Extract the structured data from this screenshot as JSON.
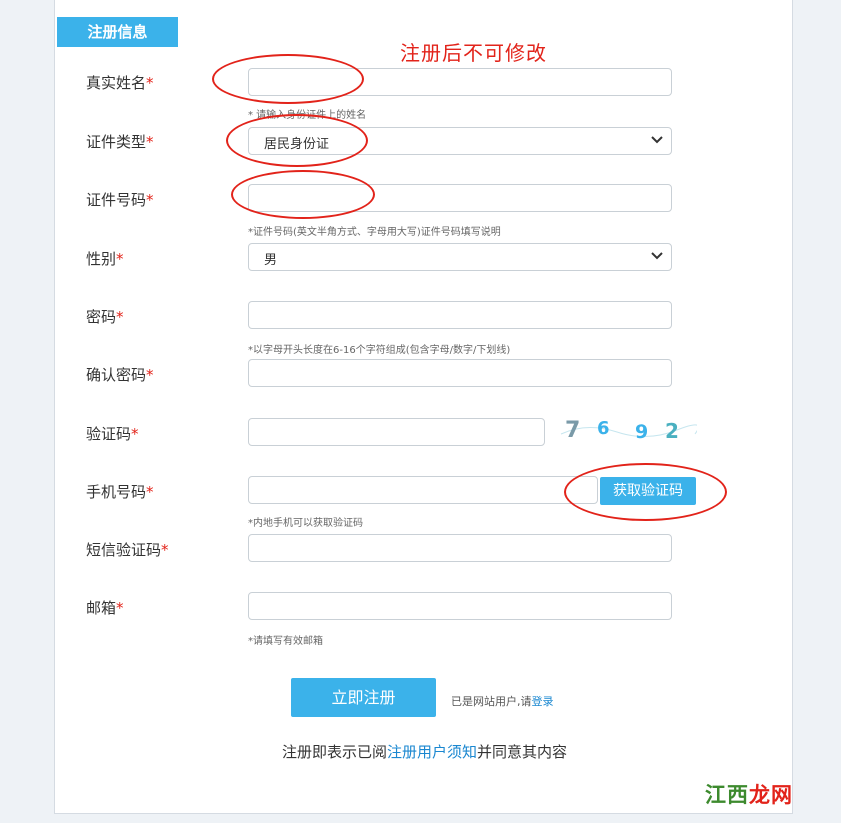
{
  "section": {
    "title": "注册信息"
  },
  "annotation": {
    "text": "注册后不可修改",
    "color": "#e2231a"
  },
  "accent_color": "#3bb2ea",
  "required_mark": "*",
  "fields": {
    "real_name": {
      "label": "真实姓名",
      "value": "",
      "hint": "* 请输入身份证件上的姓名"
    },
    "id_type": {
      "label": "证件类型",
      "value": "居民身份证"
    },
    "id_number": {
      "label": "证件号码",
      "value": "",
      "hint": "*证件号码(英文半角方式、字母用大写)证件号码填写说明"
    },
    "gender": {
      "label": "性别",
      "value": "男"
    },
    "password": {
      "label": "密码",
      "value": "",
      "hint": "*以字母开头长度在6-16个字符组成(包含字母/数字/下划线)"
    },
    "confirm_password": {
      "label": "确认密码",
      "value": ""
    },
    "captcha": {
      "label": "验证码",
      "value": "",
      "image_digits": [
        "7",
        "6",
        "9",
        "2"
      ]
    },
    "phone": {
      "label": "手机号码",
      "value": "",
      "hint": "*内地手机可以获取验证码",
      "button": "获取验证码"
    },
    "sms_code": {
      "label": "短信验证码",
      "value": ""
    },
    "email": {
      "label": "邮箱",
      "value": "",
      "hint": "*请填写有效邮箱"
    }
  },
  "submit": {
    "label": "立即注册"
  },
  "login": {
    "prefix": "已是网站用户,请",
    "link": "登录"
  },
  "agreement": {
    "prefix": "注册即表示已阅",
    "link": "注册用户须知",
    "suffix": "并同意其内容"
  },
  "watermark": {
    "part1": "江西",
    "part2": "龙网"
  }
}
